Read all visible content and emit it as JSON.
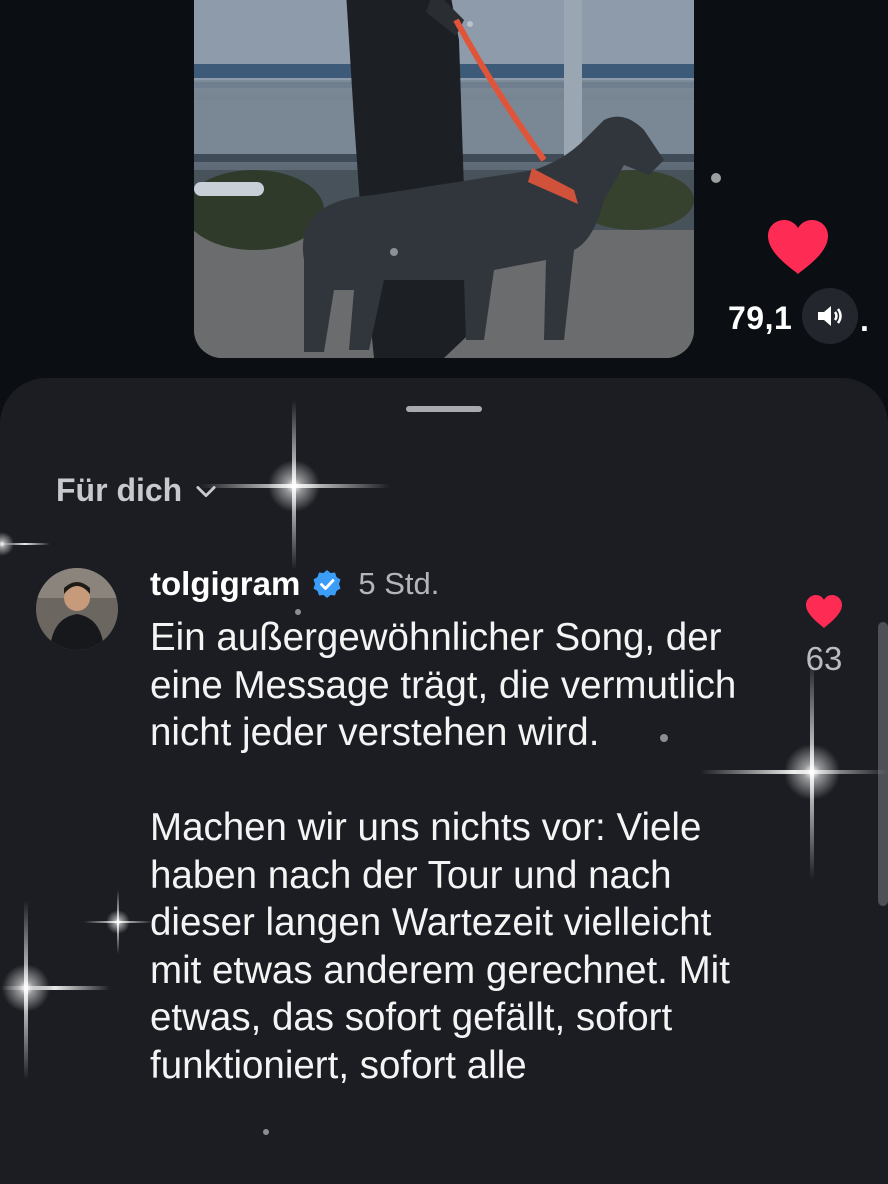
{
  "video": {
    "like_count": "79,1",
    "like_count_suffix": "."
  },
  "icons": {
    "like": "heart-icon",
    "sound": "speaker-icon",
    "filter_chevron": "chevron-down-icon",
    "verified": "verified-badge-icon"
  },
  "colors": {
    "heart": "#fe2c55",
    "verified": "#3b9df8",
    "sheet": "#1b1d22"
  },
  "comments_sheet": {
    "filter_label": "Für dich",
    "comment": {
      "username": "tolgigram",
      "time": "5 Std.",
      "like_count": "63",
      "text": "Ein außergewöhnlicher Song, der eine Message trägt, die vermutlich nicht jeder verstehen wird.\n\nMachen wir uns nichts vor: Viele haben nach der Tour und nach dieser langen Wartezeit vielleicht mit etwas anderem gerechnet. Mit etwas, das sofort gefällt, sofort funktioniert, sofort alle"
    }
  }
}
